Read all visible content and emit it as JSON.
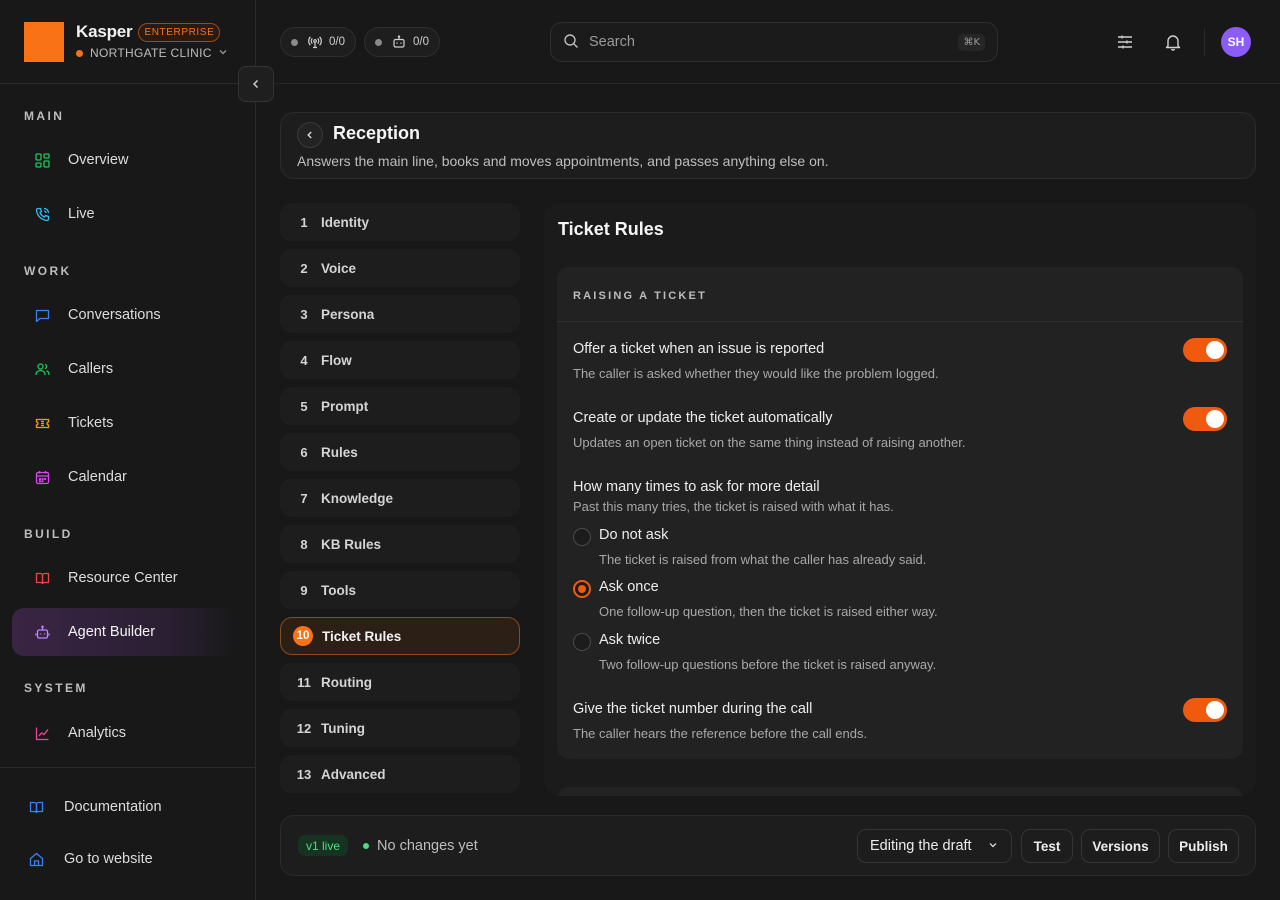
{
  "brand": {
    "name": "Kasper",
    "badge": "ENTERPRISE",
    "org": "NORTHGATE CLINIC"
  },
  "header": {
    "pill_calls": "0/0",
    "pill_agents": "0/0",
    "search_placeholder": "Search",
    "search_shortcut": "⌘K",
    "avatar_initials": "SH"
  },
  "sidebar": {
    "sections": {
      "main": "MAIN",
      "work": "WORK",
      "build": "BUILD",
      "system": "SYSTEM"
    },
    "items": {
      "overview": "Overview",
      "live": "Live",
      "conversations": "Conversations",
      "callers": "Callers",
      "tickets": "Tickets",
      "calendar": "Calendar",
      "resource_center": "Resource Center",
      "agent_builder": "Agent Builder",
      "analytics": "Analytics"
    },
    "footer": {
      "documentation": "Documentation",
      "go_to_website": "Go to website"
    }
  },
  "agent": {
    "name": "Reception",
    "description": "Answers the main line, books and moves appointments, and passes anything else on."
  },
  "steps": [
    {
      "num": "1",
      "label": "Identity"
    },
    {
      "num": "2",
      "label": "Voice"
    },
    {
      "num": "3",
      "label": "Persona"
    },
    {
      "num": "4",
      "label": "Flow"
    },
    {
      "num": "5",
      "label": "Prompt"
    },
    {
      "num": "6",
      "label": "Rules"
    },
    {
      "num": "7",
      "label": "Knowledge"
    },
    {
      "num": "8",
      "label": "KB Rules"
    },
    {
      "num": "9",
      "label": "Tools"
    },
    {
      "num": "10",
      "label": "Ticket Rules"
    },
    {
      "num": "11",
      "label": "Routing"
    },
    {
      "num": "12",
      "label": "Tuning"
    },
    {
      "num": "13",
      "label": "Advanced"
    }
  ],
  "active_step": "Ticket Rules",
  "panel": {
    "title": "Ticket Rules",
    "section_heading": "RAISING A TICKET",
    "offer_ticket": {
      "title": "Offer a ticket when an issue is reported",
      "desc": "The caller is asked whether they would like the problem logged.",
      "enabled": true
    },
    "auto_ticket": {
      "title": "Create or update the ticket automatically",
      "desc": "Updates an open ticket on the same thing instead of raising another.",
      "enabled": true
    },
    "ask_detail": {
      "title": "How many times to ask for more detail",
      "desc": "Past this many tries, the ticket is raised with what it has.",
      "options": [
        {
          "label": "Do not ask",
          "desc": "The ticket is raised from what the caller has already said."
        },
        {
          "label": "Ask once",
          "desc": "One follow-up question, then the ticket is raised either way."
        },
        {
          "label": "Ask twice",
          "desc": "Two follow-up questions before the ticket is raised anyway."
        }
      ],
      "selected": "Ask once"
    },
    "give_number": {
      "title": "Give the ticket number during the call",
      "desc": "The caller hears the reference before the call ends.",
      "enabled": true
    }
  },
  "footer_bar": {
    "version_badge": "v1 live",
    "status": "No changes yet",
    "mode_select": "Editing the draft",
    "test": "Test",
    "versions": "Versions",
    "publish": "Publish"
  },
  "colors": {
    "accent": "#f97316",
    "toggle_on": "#f05a0f",
    "live_green": "#4ade80",
    "avatar": "#8b5cf6"
  }
}
